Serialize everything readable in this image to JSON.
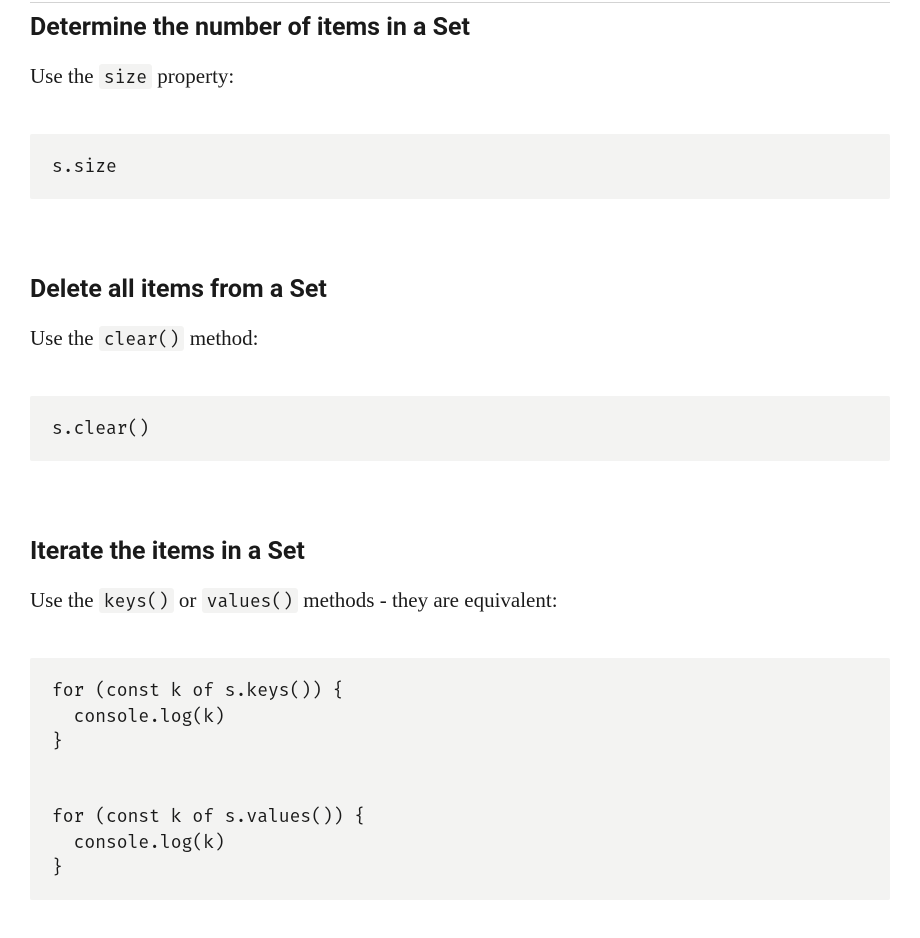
{
  "sections": [
    {
      "heading": "Determine the number of items in a Set",
      "intro_prefix": "Use the ",
      "intro_code": "size",
      "intro_suffix": " property:",
      "code": "s.size"
    },
    {
      "heading": "Delete all items from a Set",
      "intro_prefix": "Use the ",
      "intro_code": "clear()",
      "intro_suffix": " method:",
      "code": "s.clear()"
    },
    {
      "heading": "Iterate the items in a Set",
      "intro_prefix": "Use the ",
      "intro_code": "keys()",
      "intro_mid": " or ",
      "intro_code2": "values()",
      "intro_suffix": " methods - they are equivalent:",
      "code": "for (const k of s.keys()) {\n  console.log(k)\n}\n\n\nfor (const k of s.values()) {\n  console.log(k)\n}"
    }
  ]
}
